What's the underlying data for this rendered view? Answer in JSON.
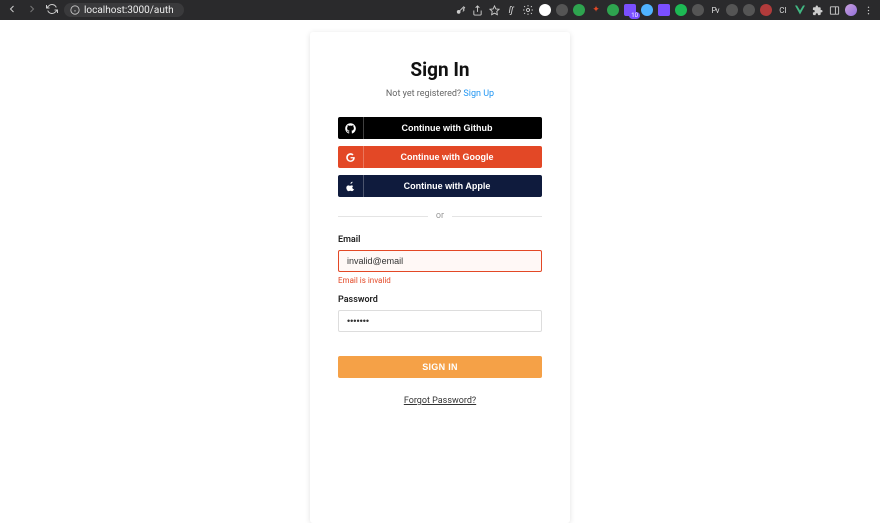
{
  "browser": {
    "url": "localhost:3000/auth"
  },
  "auth": {
    "title": "Sign In",
    "sub_prefix": "Not yet registered? ",
    "sub_link": "Sign Up",
    "github_label": "Continue with Github",
    "google_label": "Continue with Google",
    "apple_label": "Continue with Apple",
    "divider": "or",
    "email_label": "Email",
    "email_value": "invalid@email",
    "email_error": "Email is invalid",
    "password_label": "Password",
    "password_value": "•••••••",
    "submit": "SIGN IN",
    "forgot": "Forgot Password?"
  }
}
